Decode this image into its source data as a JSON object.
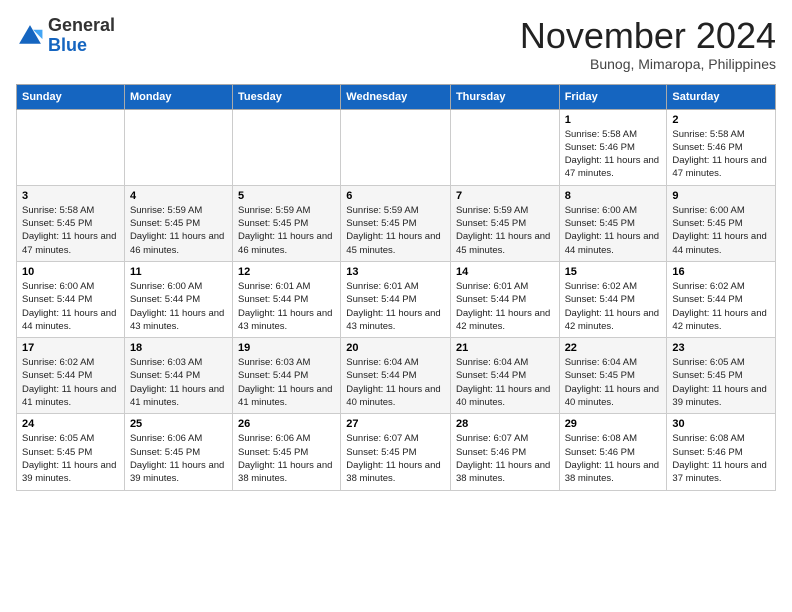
{
  "header": {
    "logo_general": "General",
    "logo_blue": "Blue",
    "month_title": "November 2024",
    "location": "Bunog, Mimaropa, Philippines"
  },
  "weekdays": [
    "Sunday",
    "Monday",
    "Tuesday",
    "Wednesday",
    "Thursday",
    "Friday",
    "Saturday"
  ],
  "weeks": [
    [
      {
        "day": "",
        "info": ""
      },
      {
        "day": "",
        "info": ""
      },
      {
        "day": "",
        "info": ""
      },
      {
        "day": "",
        "info": ""
      },
      {
        "day": "",
        "info": ""
      },
      {
        "day": "1",
        "info": "Sunrise: 5:58 AM\nSunset: 5:46 PM\nDaylight: 11 hours and 47 minutes."
      },
      {
        "day": "2",
        "info": "Sunrise: 5:58 AM\nSunset: 5:46 PM\nDaylight: 11 hours and 47 minutes."
      }
    ],
    [
      {
        "day": "3",
        "info": "Sunrise: 5:58 AM\nSunset: 5:45 PM\nDaylight: 11 hours and 47 minutes."
      },
      {
        "day": "4",
        "info": "Sunrise: 5:59 AM\nSunset: 5:45 PM\nDaylight: 11 hours and 46 minutes."
      },
      {
        "day": "5",
        "info": "Sunrise: 5:59 AM\nSunset: 5:45 PM\nDaylight: 11 hours and 46 minutes."
      },
      {
        "day": "6",
        "info": "Sunrise: 5:59 AM\nSunset: 5:45 PM\nDaylight: 11 hours and 45 minutes."
      },
      {
        "day": "7",
        "info": "Sunrise: 5:59 AM\nSunset: 5:45 PM\nDaylight: 11 hours and 45 minutes."
      },
      {
        "day": "8",
        "info": "Sunrise: 6:00 AM\nSunset: 5:45 PM\nDaylight: 11 hours and 44 minutes."
      },
      {
        "day": "9",
        "info": "Sunrise: 6:00 AM\nSunset: 5:45 PM\nDaylight: 11 hours and 44 minutes."
      }
    ],
    [
      {
        "day": "10",
        "info": "Sunrise: 6:00 AM\nSunset: 5:44 PM\nDaylight: 11 hours and 44 minutes."
      },
      {
        "day": "11",
        "info": "Sunrise: 6:00 AM\nSunset: 5:44 PM\nDaylight: 11 hours and 43 minutes."
      },
      {
        "day": "12",
        "info": "Sunrise: 6:01 AM\nSunset: 5:44 PM\nDaylight: 11 hours and 43 minutes."
      },
      {
        "day": "13",
        "info": "Sunrise: 6:01 AM\nSunset: 5:44 PM\nDaylight: 11 hours and 43 minutes."
      },
      {
        "day": "14",
        "info": "Sunrise: 6:01 AM\nSunset: 5:44 PM\nDaylight: 11 hours and 42 minutes."
      },
      {
        "day": "15",
        "info": "Sunrise: 6:02 AM\nSunset: 5:44 PM\nDaylight: 11 hours and 42 minutes."
      },
      {
        "day": "16",
        "info": "Sunrise: 6:02 AM\nSunset: 5:44 PM\nDaylight: 11 hours and 42 minutes."
      }
    ],
    [
      {
        "day": "17",
        "info": "Sunrise: 6:02 AM\nSunset: 5:44 PM\nDaylight: 11 hours and 41 minutes."
      },
      {
        "day": "18",
        "info": "Sunrise: 6:03 AM\nSunset: 5:44 PM\nDaylight: 11 hours and 41 minutes."
      },
      {
        "day": "19",
        "info": "Sunrise: 6:03 AM\nSunset: 5:44 PM\nDaylight: 11 hours and 41 minutes."
      },
      {
        "day": "20",
        "info": "Sunrise: 6:04 AM\nSunset: 5:44 PM\nDaylight: 11 hours and 40 minutes."
      },
      {
        "day": "21",
        "info": "Sunrise: 6:04 AM\nSunset: 5:44 PM\nDaylight: 11 hours and 40 minutes."
      },
      {
        "day": "22",
        "info": "Sunrise: 6:04 AM\nSunset: 5:45 PM\nDaylight: 11 hours and 40 minutes."
      },
      {
        "day": "23",
        "info": "Sunrise: 6:05 AM\nSunset: 5:45 PM\nDaylight: 11 hours and 39 minutes."
      }
    ],
    [
      {
        "day": "24",
        "info": "Sunrise: 6:05 AM\nSunset: 5:45 PM\nDaylight: 11 hours and 39 minutes."
      },
      {
        "day": "25",
        "info": "Sunrise: 6:06 AM\nSunset: 5:45 PM\nDaylight: 11 hours and 39 minutes."
      },
      {
        "day": "26",
        "info": "Sunrise: 6:06 AM\nSunset: 5:45 PM\nDaylight: 11 hours and 38 minutes."
      },
      {
        "day": "27",
        "info": "Sunrise: 6:07 AM\nSunset: 5:45 PM\nDaylight: 11 hours and 38 minutes."
      },
      {
        "day": "28",
        "info": "Sunrise: 6:07 AM\nSunset: 5:46 PM\nDaylight: 11 hours and 38 minutes."
      },
      {
        "day": "29",
        "info": "Sunrise: 6:08 AM\nSunset: 5:46 PM\nDaylight: 11 hours and 38 minutes."
      },
      {
        "day": "30",
        "info": "Sunrise: 6:08 AM\nSunset: 5:46 PM\nDaylight: 11 hours and 37 minutes."
      }
    ]
  ]
}
